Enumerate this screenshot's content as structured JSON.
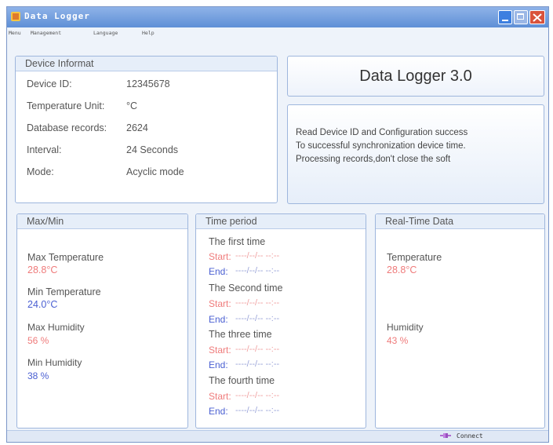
{
  "window": {
    "title": "Data Logger"
  },
  "menu": [
    "Menu",
    "Management",
    "Language",
    "Help"
  ],
  "device": {
    "heading": "Device Informat",
    "rows": [
      {
        "label": "Device ID:",
        "value": "12345678"
      },
      {
        "label": "Temperature Unit:",
        "value": "°C"
      },
      {
        "label": "Database records:",
        "value": "2624"
      },
      {
        "label": "Interval:",
        "value": "24 Seconds"
      },
      {
        "label": "Mode:",
        "value": "Acyclic mode"
      }
    ]
  },
  "brand": {
    "text": "Data Logger 3.0"
  },
  "messages": [
    "Read Device ID and Configuration success",
    "To successful synchronization device time.",
    "Processing records,don't close the soft"
  ],
  "maxmin": {
    "heading": "Max/Min",
    "items": [
      {
        "label": "Max Temperature",
        "value": "28.8°C",
        "color": "#ef7b7b"
      },
      {
        "label": "Min Temperature",
        "value": "24.0°C",
        "color": "#4a5fd2"
      },
      {
        "label": "Max Humidity",
        "value": "56 %",
        "color": "#ef7b7b"
      },
      {
        "label": "Min Humidity",
        "value": "38 %",
        "color": "#4a5fd2"
      }
    ]
  },
  "period": {
    "heading": "Time period",
    "start_label": "Start:",
    "end_label": "End:",
    "placeholder": "----/--/--  --:--",
    "groups": [
      "The first time",
      "The Second time",
      "The three time",
      "The fourth time"
    ]
  },
  "realtime": {
    "heading": "Real-Time Data",
    "temperature_label": "Temperature",
    "temperature_value": "28.8°C",
    "humidity_label": "Humidity",
    "humidity_value": "43 %"
  },
  "status": {
    "connect": "Connect"
  },
  "colors": {
    "accent_red": "#ef7b7b",
    "accent_blue": "#4a5fd2",
    "titlebar": "#5e8fd6"
  }
}
